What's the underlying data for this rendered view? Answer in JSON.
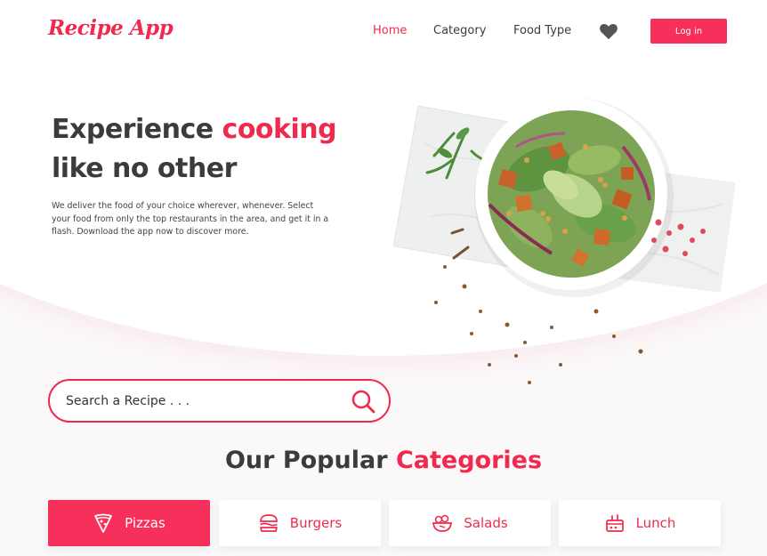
{
  "app": {
    "logo_text": "Recipe App",
    "accent_color": "#f0294f"
  },
  "nav": {
    "items": [
      {
        "label": "Home",
        "active": true
      },
      {
        "label": "Category",
        "active": false
      },
      {
        "label": "Food Type",
        "active": false
      }
    ],
    "favorites_icon": "heart-icon",
    "login_label": "Log in"
  },
  "hero": {
    "title_part1": "Experience",
    "title_accent": "cooking",
    "title_line2": "like no other",
    "description": "We deliver the food of your choice wherever, whenever. Select your food from only the top restaurants in the area, and get it in a flash. Download the app now to discover more.",
    "image": "salad-bowl-illustration"
  },
  "search": {
    "placeholder": "Search a Recipe . . .",
    "value": "",
    "icon": "search-icon"
  },
  "categories": {
    "title_part1": "Our Popular",
    "title_accent": "Categories",
    "items": [
      {
        "label": "Pizzas",
        "icon": "pizza-icon",
        "active": true
      },
      {
        "label": "Burgers",
        "icon": "burger-icon",
        "active": false
      },
      {
        "label": "Salads",
        "icon": "salad-icon",
        "active": false
      },
      {
        "label": "Lunch",
        "icon": "lunch-icon",
        "active": false
      }
    ]
  }
}
